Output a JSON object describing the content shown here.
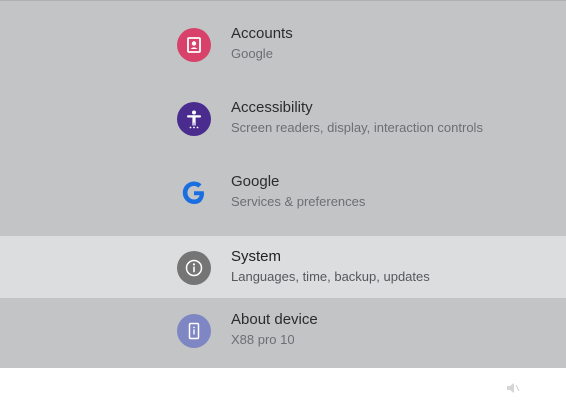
{
  "settings": {
    "items": [
      {
        "title": "Accounts",
        "subtitle": "Google",
        "icon": "account-icon",
        "color": "#d8426a"
      },
      {
        "title": "Accessibility",
        "subtitle": "Screen readers, display, interaction controls",
        "icon": "accessibility-icon",
        "color": "#4a2c8f"
      },
      {
        "title": "Google",
        "subtitle": "Services & preferences",
        "icon": "google-icon",
        "color": "#1a6fe0"
      },
      {
        "title": "System",
        "subtitle": "Languages, time, backup, updates",
        "icon": "info-icon",
        "color": "#757575"
      },
      {
        "title": "About device",
        "subtitle": "X88 pro 10",
        "icon": "device-icon",
        "color": "#7f86c4"
      }
    ]
  },
  "colors": {
    "panel": "#c2c4c6",
    "selected_row": "#dcdddf"
  },
  "status": {
    "icon": "volume-icon"
  }
}
